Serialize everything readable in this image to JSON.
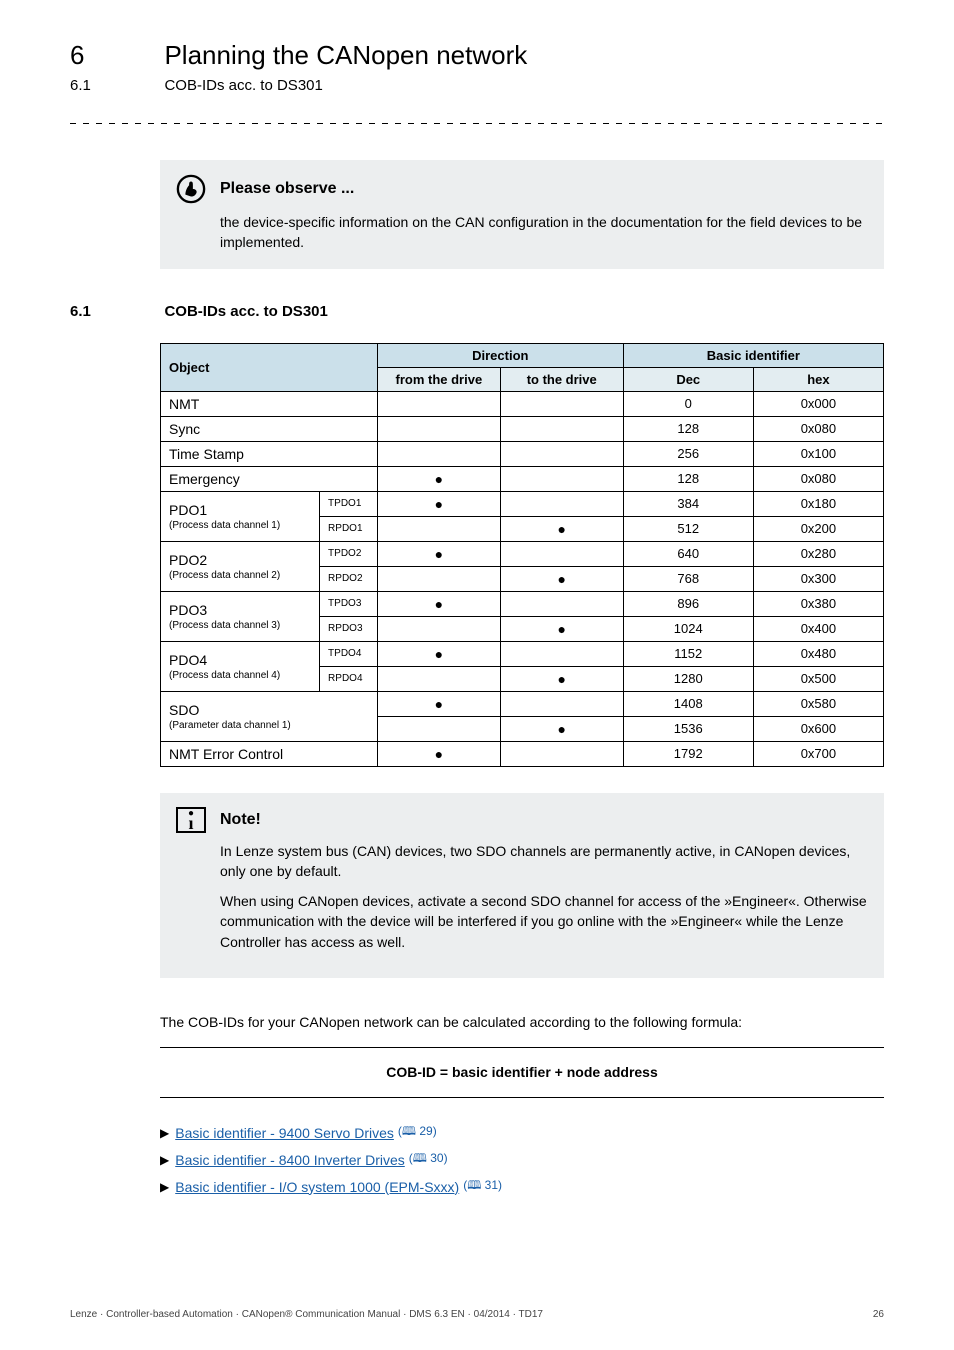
{
  "header": {
    "chapter_number": "6",
    "chapter_title": "Planning the CANopen network",
    "section_number": "6.1",
    "section_title": "COB-IDs acc. to DS301"
  },
  "observe": {
    "heading": "Please observe ...",
    "body": "the device-specific information on the CAN configuration in the documentation for the field devices to be implemented."
  },
  "section_heading": {
    "num": "6.1",
    "title": "COB-IDs acc. to DS301"
  },
  "table": {
    "head": {
      "object": "Object",
      "direction": "Direction",
      "basic_identifier": "Basic identifier",
      "from_drive": "from the drive",
      "to_drive": "to the drive",
      "dec": "Dec",
      "hex": "hex"
    },
    "simple_rows": [
      {
        "object": "NMT",
        "from": "",
        "to": "",
        "dec": "0",
        "hex": "0x000"
      },
      {
        "object": "Sync",
        "from": "",
        "to": "",
        "dec": "128",
        "hex": "0x080"
      },
      {
        "object": "Time Stamp",
        "from": "",
        "to": "",
        "dec": "256",
        "hex": "0x100"
      },
      {
        "object": "Emergency",
        "from": "●",
        "to": "",
        "dec": "128",
        "hex": "0x080"
      }
    ],
    "pdo_groups": [
      {
        "main": "PDO1",
        "sub": "(Process data channel 1)",
        "rows": [
          {
            "label": "TPDO1",
            "from": "●",
            "to": "",
            "dec": "384",
            "hex": "0x180"
          },
          {
            "label": "RPDO1",
            "from": "",
            "to": "●",
            "dec": "512",
            "hex": "0x200"
          }
        ]
      },
      {
        "main": "PDO2",
        "sub": "(Process data channel 2)",
        "rows": [
          {
            "label": "TPDO2",
            "from": "●",
            "to": "",
            "dec": "640",
            "hex": "0x280"
          },
          {
            "label": "RPDO2",
            "from": "",
            "to": "●",
            "dec": "768",
            "hex": "0x300"
          }
        ]
      },
      {
        "main": "PDO3",
        "sub": "(Process data channel 3)",
        "rows": [
          {
            "label": "TPDO3",
            "from": "●",
            "to": "",
            "dec": "896",
            "hex": "0x380"
          },
          {
            "label": "RPDO3",
            "from": "",
            "to": "●",
            "dec": "1024",
            "hex": "0x400"
          }
        ]
      },
      {
        "main": "PDO4",
        "sub": "(Process data channel 4)",
        "rows": [
          {
            "label": "TPDO4",
            "from": "●",
            "to": "",
            "dec": "1152",
            "hex": "0x480"
          },
          {
            "label": "RPDO4",
            "from": "",
            "to": "●",
            "dec": "1280",
            "hex": "0x500"
          }
        ]
      }
    ],
    "sdo_group": {
      "main": "SDO",
      "sub": "(Parameter data channel 1)",
      "rows": [
        {
          "from": "●",
          "to": "",
          "dec": "1408",
          "hex": "0x580"
        },
        {
          "from": "",
          "to": "●",
          "dec": "1536",
          "hex": "0x600"
        }
      ]
    },
    "last_row": {
      "object": "NMT Error Control",
      "from": "●",
      "to": "",
      "dec": "1792",
      "hex": "0x700"
    }
  },
  "note": {
    "heading": "Note!",
    "p1": "In Lenze system bus (CAN) devices, two SDO channels are permanently active, in CANopen devices, only one by default.",
    "p2": "When using CANopen devices, activate a second SDO channel for access of the »Engineer«. Otherwise communication with the device will be interfered if you go online with the »Engineer« while the Lenze Controller has access as well."
  },
  "formula": {
    "intro": "The COB-IDs for your CANopen network can be calculated according to the following formula:",
    "text": "COB-ID = basic identifier + node address"
  },
  "links": [
    {
      "text": "Basic identifier - 9400 Servo Drives",
      "page": "29"
    },
    {
      "text": "Basic identifier - 8400 Inverter Drives",
      "page": "30"
    },
    {
      "text": "Basic identifier - I/O system 1000 (EPM-Sxxx)",
      "page": "31"
    }
  ],
  "footer": {
    "left": "Lenze · Controller-based Automation · CANopen® Communication Manual · DMS 6.3 EN · 04/2014 · TD17",
    "right": "26"
  }
}
